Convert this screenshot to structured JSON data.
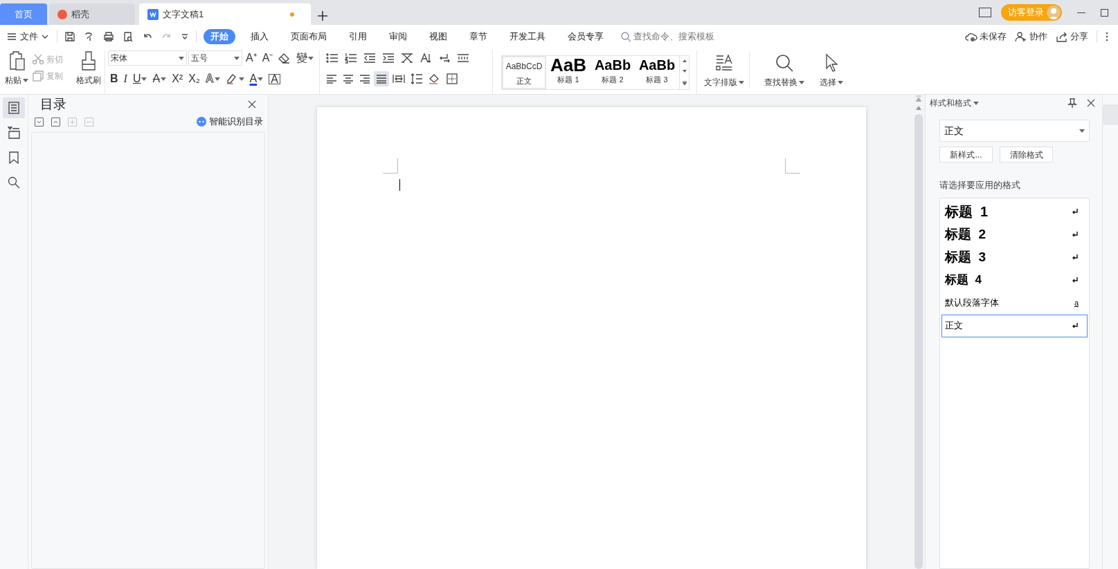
{
  "tabs": [
    {
      "label": "首页",
      "kind": "home",
      "selected": false
    },
    {
      "label": "稻壳",
      "kind": "daoke",
      "selected": false
    },
    {
      "label": "文字文稿1",
      "kind": "doc",
      "selected": true,
      "modified": true
    }
  ],
  "login_button": "访客登录",
  "menu": {
    "file": "文件",
    "ribbon_tabs": [
      {
        "label": "开始",
        "selected": true
      },
      {
        "label": "插入",
        "selected": false
      },
      {
        "label": "页面布局",
        "selected": false
      },
      {
        "label": "引用",
        "selected": false
      },
      {
        "label": "审阅",
        "selected": false
      },
      {
        "label": "视图",
        "selected": false
      },
      {
        "label": "章节",
        "selected": false
      },
      {
        "label": "开发工具",
        "selected": false
      },
      {
        "label": "会员专享",
        "selected": false
      }
    ],
    "search": {
      "placeholder": "查找命令、搜索模板"
    },
    "actions": [
      {
        "label": "未保存",
        "kind": "cloud"
      },
      {
        "label": "协作",
        "kind": "person"
      },
      {
        "label": "分享",
        "kind": "share"
      }
    ]
  },
  "ribbon": {
    "paste": "粘贴",
    "cut": {
      "label": "剪切",
      "disabled": true
    },
    "copy": {
      "label": "复制",
      "disabled": true
    },
    "format_painter": "格式刷",
    "font": "宋体",
    "size": "五号",
    "font_tools_top": [
      {
        "kind": "text",
        "glyph": "A⁺"
      },
      {
        "kind": "text",
        "glyph": "A⁻"
      },
      {
        "kind": "eraser"
      },
      {
        "kind": "text",
        "glyph": "變",
        "caret": true
      }
    ],
    "font_tools_bottom": [
      {
        "kind": "text",
        "glyph": "B"
      },
      {
        "kind": "text",
        "glyph": "I"
      },
      {
        "kind": "text",
        "glyph": "U",
        "caret": true
      },
      {
        "kind": "text",
        "glyph": "A",
        "caret": true
      },
      {
        "kind": "text",
        "glyph": "X²"
      },
      {
        "kind": "text",
        "glyph": "X₂"
      },
      {
        "kind": "text",
        "glyph": "A",
        "caret": true
      },
      {
        "kind": "highlight",
        "caret": true
      },
      {
        "kind": "text",
        "glyph": "A",
        "caret": true
      },
      {
        "kind": "text",
        "glyph": "A"
      }
    ],
    "para_tools_top": [
      {
        "kind": "bullets",
        "selected": false
      },
      {
        "kind": "numbering",
        "selected": false
      },
      {
        "kind": "outdent",
        "selected": false
      },
      {
        "kind": "indent",
        "selected": false
      },
      {
        "kind": "asian",
        "selected": false
      },
      {
        "kind": "sort",
        "selected": false
      },
      {
        "kind": "marks",
        "selected": false
      },
      {
        "kind": "table-lines",
        "selected": false
      }
    ],
    "para_tools_bottom": [
      {
        "kind": "align-left",
        "selected": false
      },
      {
        "kind": "align-center",
        "selected": false
      },
      {
        "kind": "align-right",
        "selected": false
      },
      {
        "kind": "justify",
        "selected": true
      },
      {
        "kind": "distribute",
        "selected": false
      },
      {
        "kind": "line-spacing",
        "selected": false
      },
      {
        "kind": "shading",
        "selected": false
      },
      {
        "kind": "borders",
        "selected": false
      }
    ],
    "styles": [
      {
        "preview": "AaBbCcD",
        "label": "正文",
        "selected": true
      },
      {
        "preview": "AaB",
        "label": "标题 1",
        "selected": false
      },
      {
        "preview": "AaBb",
        "label": "标题 2",
        "selected": false
      },
      {
        "preview": "AaBb",
        "label": "标题 3",
        "selected": false
      }
    ],
    "tools": [
      {
        "label": "文字排版",
        "kind": "layout"
      },
      {
        "label": "查找替换",
        "kind": "find"
      },
      {
        "label": "选择",
        "kind": "select"
      }
    ]
  },
  "toc_panel": {
    "title": "目录",
    "smart_button": "智能识别目录",
    "controls": [
      {
        "kind": "expand",
        "disabled": false
      },
      {
        "kind": "collapse",
        "disabled": false
      },
      {
        "kind": "plus",
        "disabled": true
      },
      {
        "kind": "minus",
        "disabled": true
      }
    ]
  },
  "nav": [
    {
      "kind": "outline",
      "selected": true
    },
    {
      "kind": "chapters",
      "selected": false
    },
    {
      "kind": "bookmark",
      "selected": false
    },
    {
      "kind": "search",
      "selected": false
    }
  ],
  "styles_panel": {
    "title": "样式和格式",
    "current": "正文",
    "buttons": [
      "新样式...",
      "清除格式"
    ],
    "prompt": "请选择要应用的格式",
    "items": [
      {
        "label": "标题  1",
        "kind": "paragraph",
        "selected": false
      },
      {
        "label": "标题  2",
        "kind": "paragraph",
        "selected": false
      },
      {
        "label": "标题  3",
        "kind": "paragraph",
        "selected": false
      },
      {
        "label": "标题  4",
        "kind": "paragraph",
        "selected": false
      },
      {
        "label": "默认段落字体",
        "kind": "character",
        "mark": "a",
        "selected": false
      },
      {
        "label": "正文",
        "kind": "paragraph",
        "selected": true
      }
    ]
  }
}
